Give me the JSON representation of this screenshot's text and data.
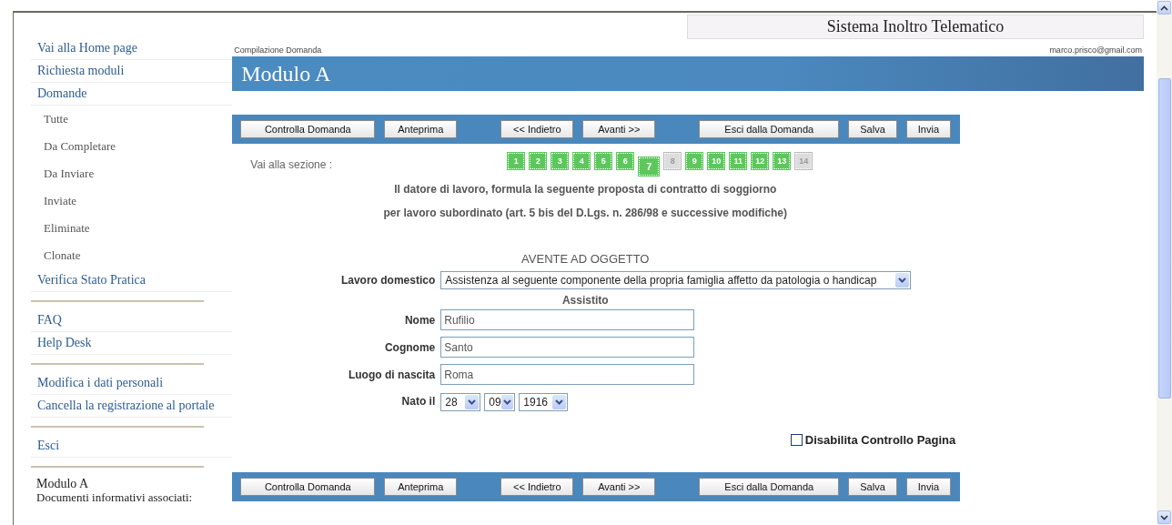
{
  "header": {
    "site_title": "Sistema Inoltro Telematico",
    "breadcrumb": "Compilazione Domanda",
    "user_email": "marco.prisco@gmail.com",
    "page_title": "Modulo A"
  },
  "sidebar": {
    "groups": [
      [
        {
          "label": "Vai alla Home page"
        },
        {
          "label": "Richiesta moduli"
        },
        {
          "label": "Domande",
          "children": [
            {
              "label": "Tutte"
            },
            {
              "label": "Da Completare"
            },
            {
              "label": "Da Inviare"
            },
            {
              "label": "Inviate"
            },
            {
              "label": "Eliminate"
            },
            {
              "label": "Clonate"
            }
          ]
        },
        {
          "label": "Verifica Stato Pratica"
        }
      ],
      [
        {
          "label": "FAQ"
        },
        {
          "label": "Help Desk"
        }
      ],
      [
        {
          "label": "Modifica i dati personali"
        },
        {
          "label": "Cancella la registrazione al portale"
        }
      ],
      [
        {
          "label": "Esci"
        }
      ]
    ],
    "footer": [
      "Modulo A",
      "Documenti informativi associati:"
    ]
  },
  "top_toolbar": [
    [
      "Controlla Domanda",
      "Anteprima"
    ],
    [
      "<< Indietro",
      "Avanti >>"
    ],
    [
      "Esci dalla Domanda",
      "Salva",
      "Invia"
    ]
  ],
  "sections": {
    "label": "Vai alla sezione :",
    "items": [
      {
        "label": "1",
        "selected": false,
        "disabled": false
      },
      {
        "label": "2",
        "selected": false,
        "disabled": false
      },
      {
        "label": "3",
        "selected": false,
        "disabled": false
      },
      {
        "label": "4",
        "selected": false,
        "disabled": false
      },
      {
        "label": "5",
        "selected": false,
        "disabled": false
      },
      {
        "label": "6",
        "selected": false,
        "disabled": false
      },
      {
        "label": "7",
        "selected": true,
        "disabled": false
      },
      {
        "label": "8",
        "selected": false,
        "disabled": true
      },
      {
        "label": "9",
        "selected": false,
        "disabled": false
      },
      {
        "label": "10",
        "selected": false,
        "disabled": false
      },
      {
        "label": "11",
        "selected": false,
        "disabled": false
      },
      {
        "label": "12",
        "selected": false,
        "disabled": false
      },
      {
        "label": "13",
        "selected": false,
        "disabled": false
      },
      {
        "label": "14",
        "selected": false,
        "disabled": true
      }
    ]
  },
  "intro": [
    "Il datore di lavoro, formula la seguente proposta di contratto di soggiorno",
    "per lavoro subordinato (art. 5 bis del D.Lgs. n. 286/98 e successive modifiche)"
  ],
  "form": {
    "title": "AVENTE AD OGGETTO",
    "rows": [
      {
        "kind": "select",
        "label": "Lavoro domestico",
        "value": "Assistenza al seguente componente della propria famiglia affetto da patologia o handicap"
      },
      {
        "kind": "subheading",
        "label": "Assistito"
      },
      {
        "kind": "text",
        "label": "Nome",
        "value": "Rufilio"
      },
      {
        "kind": "text",
        "label": "Cognome",
        "value": "Santo"
      },
      {
        "kind": "text",
        "label": "Luogo di nascita",
        "value": "Roma"
      },
      {
        "kind": "date",
        "label": "Nato il",
        "parts": [
          "28",
          "09",
          "1916"
        ]
      }
    ]
  },
  "disable_check": {
    "label": "Disabilita Controllo Pagina",
    "checked": false
  },
  "bottom_toolbar": [
    [
      "Controlla Domanda",
      "Anteprima"
    ],
    [
      "<< Indietro",
      "Avanti >>"
    ],
    [
      "Esci dalla Domanda",
      "Salva",
      "Invia"
    ]
  ]
}
